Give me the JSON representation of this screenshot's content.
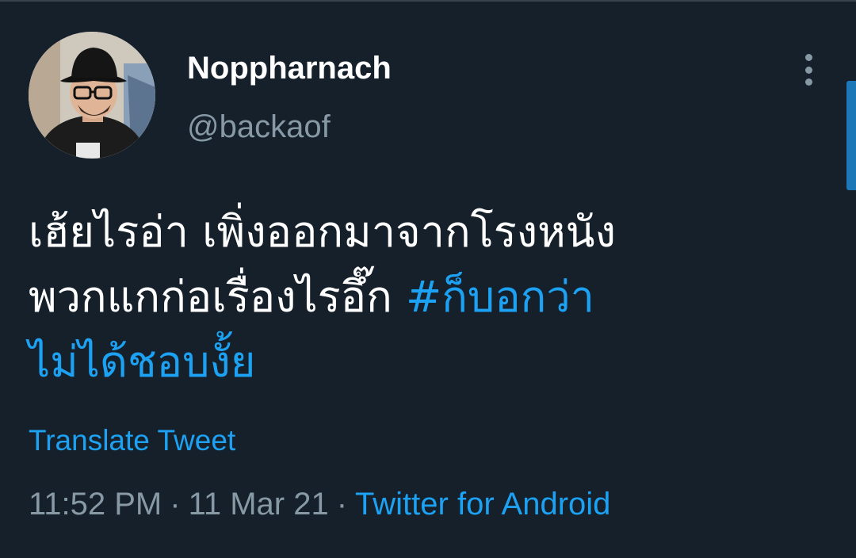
{
  "tweet": {
    "author": {
      "display_name": "Noppharnach",
      "handle": "@backaof",
      "avatar_icon": "user-avatar"
    },
    "more_icon": "more-vertical-icon",
    "text": {
      "line1": "เฮ้ยไรอ่า เพิ่งออกมาจากโรงหนัง",
      "line2_plain": "พวกแกก่อเรื่องไรอึ๊ก ",
      "line2_hashtag": "#ก็บอกว่า",
      "line3_hashtag": "ไม่ได้ชอบงั้ย"
    },
    "translate_label": "Translate Tweet",
    "meta": {
      "time": "11:52 PM",
      "separator": "·",
      "date": "11 Mar 21",
      "source": "Twitter for Android"
    }
  },
  "colors": {
    "background": "#15202b",
    "text": "#ffffff",
    "secondary": "#8899a6",
    "accent": "#1da1f2"
  }
}
